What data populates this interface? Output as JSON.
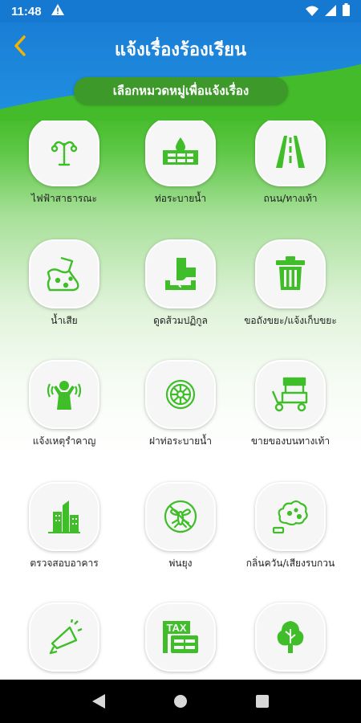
{
  "status_bar": {
    "time": "11:48",
    "warning_icon": "warning-icon",
    "wifi_icon": "wifi-icon",
    "signal_icon": "signal-icon",
    "battery_icon": "battery-icon"
  },
  "header": {
    "title": "แจ้งเรื่องร้องเรียน",
    "subtitle": "เลือกหมวดหมู่เพื่อแจ้งเรื่อง",
    "back_icon": "back-chevron-icon"
  },
  "colors": {
    "status_bar": "#1679d1",
    "header_blue": "#1c86dc",
    "green": "#3db82b",
    "icon_green": "#3fbe2a"
  },
  "categories": [
    {
      "label": "ไฟฟ้าสาธารณะ",
      "icon": "street-light-icon"
    },
    {
      "label": "ท่อระบายน้ำ",
      "icon": "drain-pipe-icon"
    },
    {
      "label": "ถนน/ทางเท้า",
      "icon": "road-icon"
    },
    {
      "label": "น้ำเสีย",
      "icon": "wastewater-icon"
    },
    {
      "label": "ดูดส้วมปฏิกูล",
      "icon": "sewage-pump-icon"
    },
    {
      "label": "ขอถังขยะ/แจ้งเก็บขยะ",
      "icon": "trash-bin-icon"
    },
    {
      "label": "แจ้งเหตุรำคาญ",
      "icon": "nuisance-icon"
    },
    {
      "label": "ฝาท่อระบายน้ำ",
      "icon": "manhole-cover-icon"
    },
    {
      "label": "ขายของบนทางเท้า",
      "icon": "street-vendor-icon"
    },
    {
      "label": "ตรวจสอบอาคาร",
      "icon": "building-icon"
    },
    {
      "label": "พ่นยุง",
      "icon": "mosquito-icon"
    },
    {
      "label": "กลิ่นควัน/เสียงรบกวน",
      "icon": "smoke-noise-icon"
    },
    {
      "label": "",
      "icon": "megaphone-icon"
    },
    {
      "label": "",
      "icon": "tax-icon"
    },
    {
      "label": "",
      "icon": "tree-icon"
    }
  ],
  "nav": {
    "back": "nav-back-icon",
    "home": "nav-home-icon",
    "recents": "nav-recents-icon"
  }
}
